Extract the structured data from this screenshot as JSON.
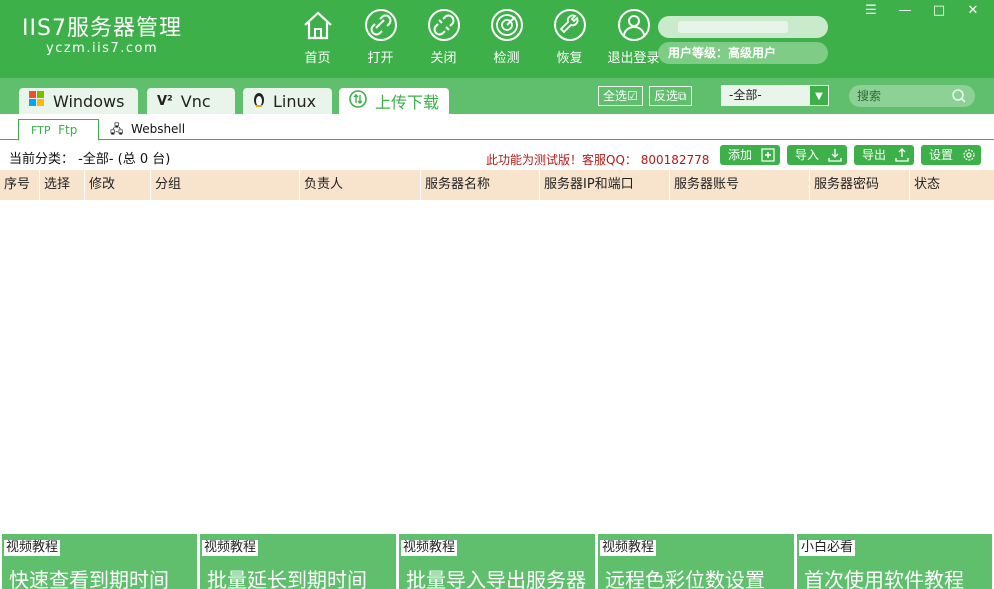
{
  "app": {
    "logo_main": "IIS7服务器管理",
    "logo_sub": "yczm.iis7.com"
  },
  "nav": {
    "home": "首页",
    "open": "打开",
    "close": "关闭",
    "check": "检测",
    "restore": "恢复",
    "logout": "退出登录"
  },
  "user": {
    "level": "用户等级：高级用户"
  },
  "window": {
    "menu": "☰",
    "minimize": "—",
    "maximize": "□",
    "close": "✕"
  },
  "tabs": {
    "windows": "Windows",
    "vnc": "Vnc",
    "linux": "Linux",
    "upload": "上传下载"
  },
  "toolbar": {
    "select_all": "全选",
    "invert": "反选",
    "category_selected": "-全部-",
    "search_placeholder": "搜索"
  },
  "subtabs": {
    "ftp_prefix": "FTP",
    "ftp": "Ftp",
    "webshell": "Webshell"
  },
  "info": {
    "category": "当前分类： -全部- (总 0 台)",
    "notice": "此功能为测试版！客服QQ： 800182778"
  },
  "actions": {
    "add": "添加",
    "import": "导入",
    "export": "导出",
    "settings": "设置"
  },
  "table": {
    "columns": [
      "序号",
      "选择",
      "修改",
      "分组",
      "负责人",
      "服务器名称",
      "服务器IP和端口",
      "服务器账号",
      "服务器密码",
      "状态"
    ]
  },
  "banners": [
    {
      "tag": "视频教程",
      "text": "快速查看到期时间"
    },
    {
      "tag": "视频教程",
      "text": "批量延长到期时间"
    },
    {
      "tag": "视频教程",
      "text": "批量导入导出服务器"
    },
    {
      "tag": "视频教程",
      "text": "远程色彩位数设置"
    },
    {
      "tag": "小白必看",
      "text": "首次使用软件教程"
    }
  ],
  "colors": {
    "primary": "#3db04a",
    "tab_strip": "#5fbf6c",
    "header_row": "#f8e3cc",
    "notice": "#b21a1a"
  }
}
